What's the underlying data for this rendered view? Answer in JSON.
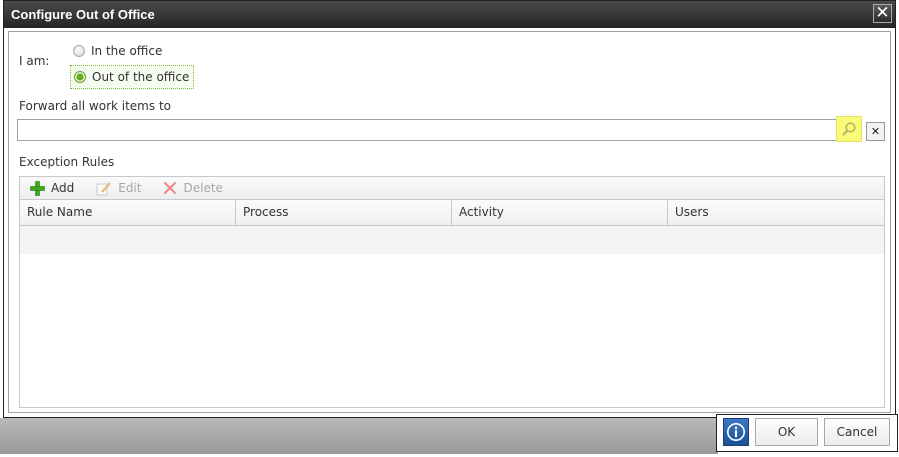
{
  "dialog": {
    "title": "Configure Out of Office",
    "close_glyph": "✕"
  },
  "status": {
    "label": "I am:",
    "options": [
      {
        "label": "In the office",
        "selected": false
      },
      {
        "label": "Out of the office",
        "selected": true
      }
    ]
  },
  "forward": {
    "label": "Forward all work items to",
    "value": "",
    "lookup_icon": "search-icon",
    "clear_glyph": "✕"
  },
  "rules": {
    "label": "Exception Rules",
    "toolbar": {
      "add": "Add",
      "edit": "Edit",
      "delete": "Delete"
    },
    "columns": [
      "Rule Name",
      "Process",
      "Activity",
      "Users"
    ],
    "rows": []
  },
  "footer": {
    "info_icon": "info-icon",
    "ok": "OK",
    "cancel": "Cancel"
  },
  "colors": {
    "titlebar": "#2e2e2e",
    "selected_radio": "#5fae1a",
    "lookup_highlight": "#fbfb7a",
    "info_button": "#2a62ad"
  }
}
